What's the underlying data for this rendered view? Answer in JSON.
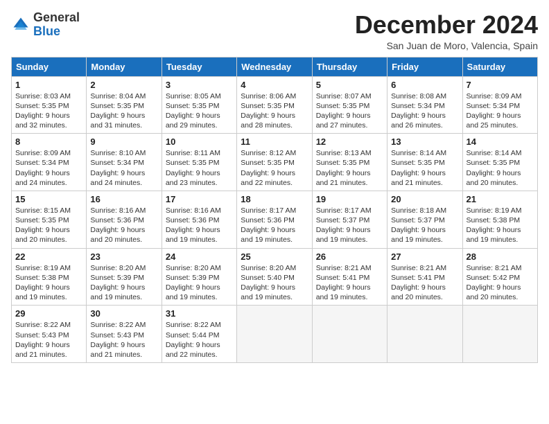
{
  "logo": {
    "general": "General",
    "blue": "Blue"
  },
  "header": {
    "month": "December 2024",
    "location": "San Juan de Moro, Valencia, Spain"
  },
  "weekdays": [
    "Sunday",
    "Monday",
    "Tuesday",
    "Wednesday",
    "Thursday",
    "Friday",
    "Saturday"
  ],
  "weeks": [
    [
      {
        "day": "1",
        "info": "Sunrise: 8:03 AM\nSunset: 5:35 PM\nDaylight: 9 hours and 32 minutes."
      },
      {
        "day": "2",
        "info": "Sunrise: 8:04 AM\nSunset: 5:35 PM\nDaylight: 9 hours and 31 minutes."
      },
      {
        "day": "3",
        "info": "Sunrise: 8:05 AM\nSunset: 5:35 PM\nDaylight: 9 hours and 29 minutes."
      },
      {
        "day": "4",
        "info": "Sunrise: 8:06 AM\nSunset: 5:35 PM\nDaylight: 9 hours and 28 minutes."
      },
      {
        "day": "5",
        "info": "Sunrise: 8:07 AM\nSunset: 5:35 PM\nDaylight: 9 hours and 27 minutes."
      },
      {
        "day": "6",
        "info": "Sunrise: 8:08 AM\nSunset: 5:34 PM\nDaylight: 9 hours and 26 minutes."
      },
      {
        "day": "7",
        "info": "Sunrise: 8:09 AM\nSunset: 5:34 PM\nDaylight: 9 hours and 25 minutes."
      }
    ],
    [
      {
        "day": "8",
        "info": "Sunrise: 8:09 AM\nSunset: 5:34 PM\nDaylight: 9 hours and 24 minutes."
      },
      {
        "day": "9",
        "info": "Sunrise: 8:10 AM\nSunset: 5:34 PM\nDaylight: 9 hours and 24 minutes."
      },
      {
        "day": "10",
        "info": "Sunrise: 8:11 AM\nSunset: 5:35 PM\nDaylight: 9 hours and 23 minutes."
      },
      {
        "day": "11",
        "info": "Sunrise: 8:12 AM\nSunset: 5:35 PM\nDaylight: 9 hours and 22 minutes."
      },
      {
        "day": "12",
        "info": "Sunrise: 8:13 AM\nSunset: 5:35 PM\nDaylight: 9 hours and 21 minutes."
      },
      {
        "day": "13",
        "info": "Sunrise: 8:14 AM\nSunset: 5:35 PM\nDaylight: 9 hours and 21 minutes."
      },
      {
        "day": "14",
        "info": "Sunrise: 8:14 AM\nSunset: 5:35 PM\nDaylight: 9 hours and 20 minutes."
      }
    ],
    [
      {
        "day": "15",
        "info": "Sunrise: 8:15 AM\nSunset: 5:35 PM\nDaylight: 9 hours and 20 minutes."
      },
      {
        "day": "16",
        "info": "Sunrise: 8:16 AM\nSunset: 5:36 PM\nDaylight: 9 hours and 20 minutes."
      },
      {
        "day": "17",
        "info": "Sunrise: 8:16 AM\nSunset: 5:36 PM\nDaylight: 9 hours and 19 minutes."
      },
      {
        "day": "18",
        "info": "Sunrise: 8:17 AM\nSunset: 5:36 PM\nDaylight: 9 hours and 19 minutes."
      },
      {
        "day": "19",
        "info": "Sunrise: 8:17 AM\nSunset: 5:37 PM\nDaylight: 9 hours and 19 minutes."
      },
      {
        "day": "20",
        "info": "Sunrise: 8:18 AM\nSunset: 5:37 PM\nDaylight: 9 hours and 19 minutes."
      },
      {
        "day": "21",
        "info": "Sunrise: 8:19 AM\nSunset: 5:38 PM\nDaylight: 9 hours and 19 minutes."
      }
    ],
    [
      {
        "day": "22",
        "info": "Sunrise: 8:19 AM\nSunset: 5:38 PM\nDaylight: 9 hours and 19 minutes."
      },
      {
        "day": "23",
        "info": "Sunrise: 8:20 AM\nSunset: 5:39 PM\nDaylight: 9 hours and 19 minutes."
      },
      {
        "day": "24",
        "info": "Sunrise: 8:20 AM\nSunset: 5:39 PM\nDaylight: 9 hours and 19 minutes."
      },
      {
        "day": "25",
        "info": "Sunrise: 8:20 AM\nSunset: 5:40 PM\nDaylight: 9 hours and 19 minutes."
      },
      {
        "day": "26",
        "info": "Sunrise: 8:21 AM\nSunset: 5:41 PM\nDaylight: 9 hours and 19 minutes."
      },
      {
        "day": "27",
        "info": "Sunrise: 8:21 AM\nSunset: 5:41 PM\nDaylight: 9 hours and 20 minutes."
      },
      {
        "day": "28",
        "info": "Sunrise: 8:21 AM\nSunset: 5:42 PM\nDaylight: 9 hours and 20 minutes."
      }
    ],
    [
      {
        "day": "29",
        "info": "Sunrise: 8:22 AM\nSunset: 5:43 PM\nDaylight: 9 hours and 21 minutes."
      },
      {
        "day": "30",
        "info": "Sunrise: 8:22 AM\nSunset: 5:43 PM\nDaylight: 9 hours and 21 minutes."
      },
      {
        "day": "31",
        "info": "Sunrise: 8:22 AM\nSunset: 5:44 PM\nDaylight: 9 hours and 22 minutes."
      },
      null,
      null,
      null,
      null
    ]
  ]
}
